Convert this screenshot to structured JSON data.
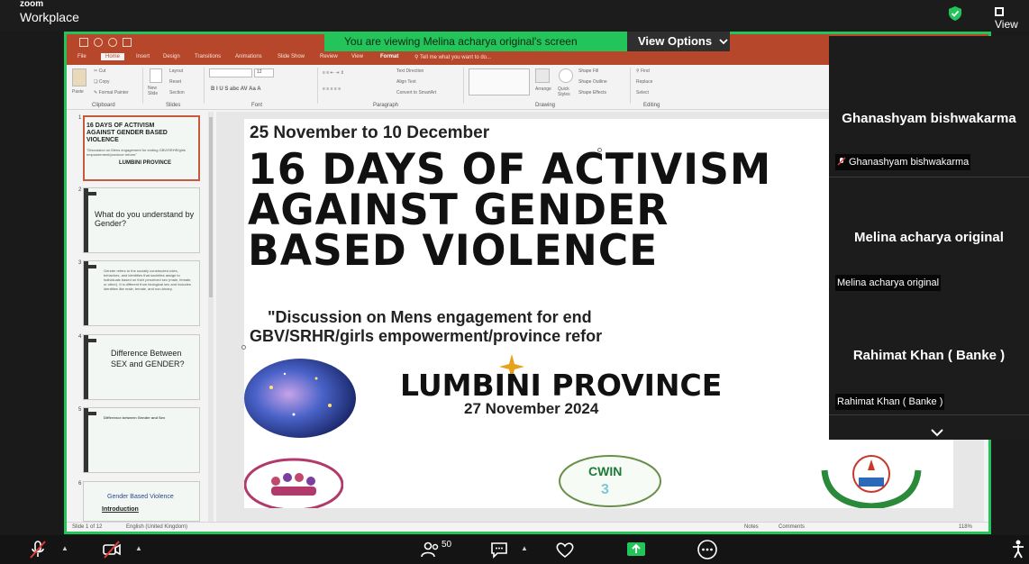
{
  "app": {
    "brand_line1": "zoom",
    "brand_line2": "Workplace",
    "view_label": "View"
  },
  "share": {
    "banner": "You are viewing  Melina acharya original's screen",
    "view_options": "View Options"
  },
  "ppt": {
    "tabs": [
      "File",
      "Home",
      "Insert",
      "Design",
      "Transitions",
      "Animations",
      "Slide Show",
      "Review",
      "View",
      "Format"
    ],
    "active_tab": "Home",
    "tell_me": "Tell me what you want to do...",
    "ribbon": {
      "paste": "Paste",
      "cut": "Cut",
      "copy": "Copy",
      "format_painter": "Format Painter",
      "new_slide": "New Slide",
      "layout": "Layout",
      "reset": "Reset",
      "section": "Section",
      "font_size": "12",
      "text_direction": "Text Direction",
      "align_text": "Align Text",
      "convert_smartart": "Convert to SmartArt",
      "arrange": "Arrange",
      "quick_styles": "Quick Styles",
      "shape_fill": "Shape Fill",
      "shape_outline": "Shape Outline",
      "shape_effects": "Shape Effects",
      "find": "Find",
      "replace": "Replace",
      "select": "Select",
      "groups": [
        "Clipboard",
        "Slides",
        "Font",
        "Paragraph",
        "Drawing",
        "Editing"
      ]
    },
    "thumbnails": [
      {
        "num": "1",
        "title": "16 DAYS OF ACTIVISM AGAINST GENDER BASED VIOLENCE",
        "sub": "\"Discussion on Mens engagement for ending GBV/SRHR/girls empowerment/province reform\"",
        "prov": "LUMBINI PROVINCE"
      },
      {
        "num": "2",
        "text": "What do you understand by Gender?"
      },
      {
        "num": "3",
        "text": "Gender refers to the socially constructed roles, behaviors, and identities that societies assign to individuals based on their perceived sex (male, female, or other). It is different from biological sex and includes identities like male, female, and non-binary."
      },
      {
        "num": "4",
        "text": "Difference Between SEX and GENDER?"
      },
      {
        "num": "5",
        "text": "Difference between Gender and Sex"
      },
      {
        "num": "6",
        "text": "Gender Based Violence",
        "text2": "Introduction"
      }
    ],
    "slide": {
      "date_range": "25 November to 10 December",
      "title": "16 DAYS OF ACTIVISM AGAINST GENDER BASED VIOLENCE",
      "discussion": "    \"Discussion on Mens engagement for end\nGBV/SRHR/girls empowerment/province refor",
      "province": "LUMBINI PROVINCE",
      "event_date": "27 November 2024"
    },
    "status": {
      "slide_of": "Slide 1 of 12",
      "language": "English (United Kingdom)",
      "notes": "Notes",
      "comments": "Comments",
      "zoom": "118%"
    }
  },
  "participants": [
    {
      "name": "Ghanashyam bishwakarma",
      "label": "Ghanashyam bishwakarma",
      "muted": true
    },
    {
      "name": "Melina acharya original",
      "label": "Melina acharya original",
      "muted": false
    },
    {
      "name": "Rahimat Khan ( Banke )",
      "label": "Rahimat Khan ( Banke )",
      "muted": false
    }
  ],
  "toolbar": {
    "participant_count": "50"
  },
  "colors": {
    "share_border": "#23c45a",
    "ppt_accent": "#b7472a"
  }
}
